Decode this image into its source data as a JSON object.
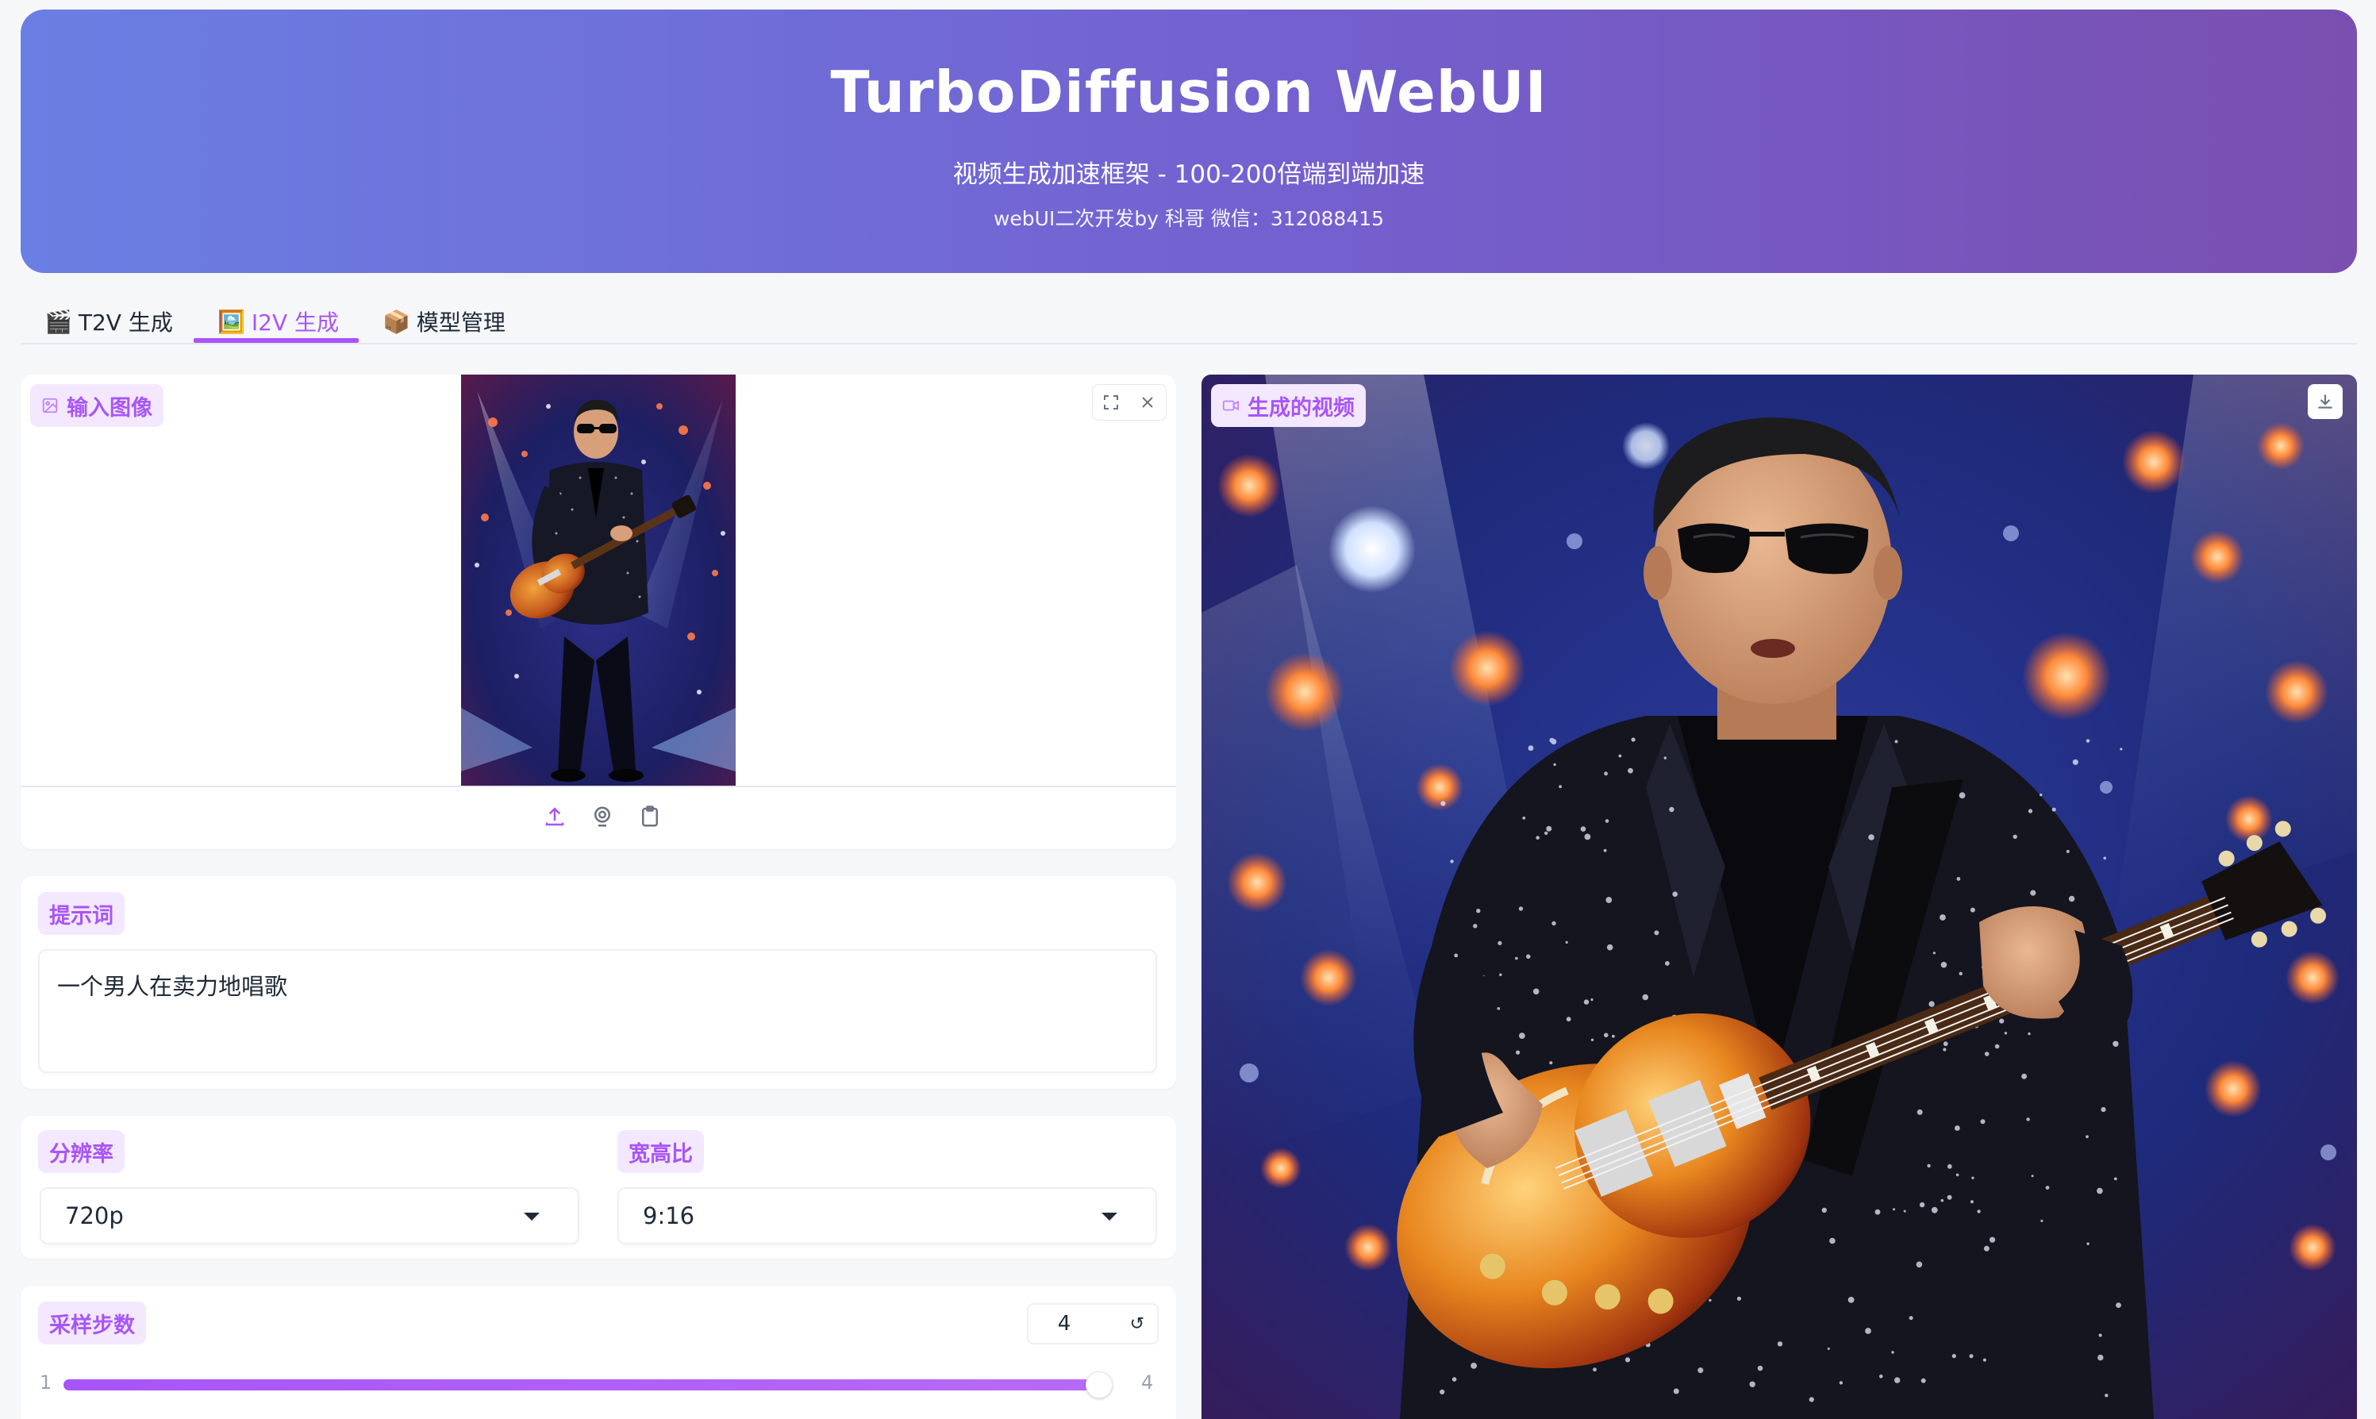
{
  "header": {
    "title": "TurboDiffusion WebUI",
    "subtitle": "视频生成加速框架 - 100-200倍端到端加速",
    "credit": "webUI二次开发by 科哥 微信：312088415"
  },
  "tabs": [
    {
      "icon": "🎬",
      "label": "T2V 生成",
      "active": false
    },
    {
      "icon": "🖼️",
      "label": "I2V 生成",
      "active": true
    },
    {
      "icon": "📦",
      "label": "模型管理",
      "active": false
    }
  ],
  "input_image": {
    "label": "输入图像",
    "icons": [
      "upload-icon",
      "webcam-icon",
      "clipboard-icon"
    ],
    "toolbar_icons": [
      "fullscreen-icon",
      "close-icon"
    ]
  },
  "prompt": {
    "label": "提示词",
    "value": "一个男人在卖力地唱歌"
  },
  "resolution": {
    "label": "分辨率",
    "value": "720p"
  },
  "aspect_ratio": {
    "label": "宽高比",
    "value": "9:16"
  },
  "sampling_steps": {
    "label": "采样步数",
    "value": "4",
    "min": "1",
    "max": "4",
    "reset_icon": "↺",
    "fraction": 1.0
  },
  "output_video": {
    "label": "生成的视频",
    "icons": [
      "video-icon",
      "download-icon"
    ]
  },
  "colors": {
    "accent": "#a855f7",
    "chip_bg": "#f3e8ff",
    "banner_start": "#6a7fe3",
    "banner_end": "#7a4fb0"
  }
}
